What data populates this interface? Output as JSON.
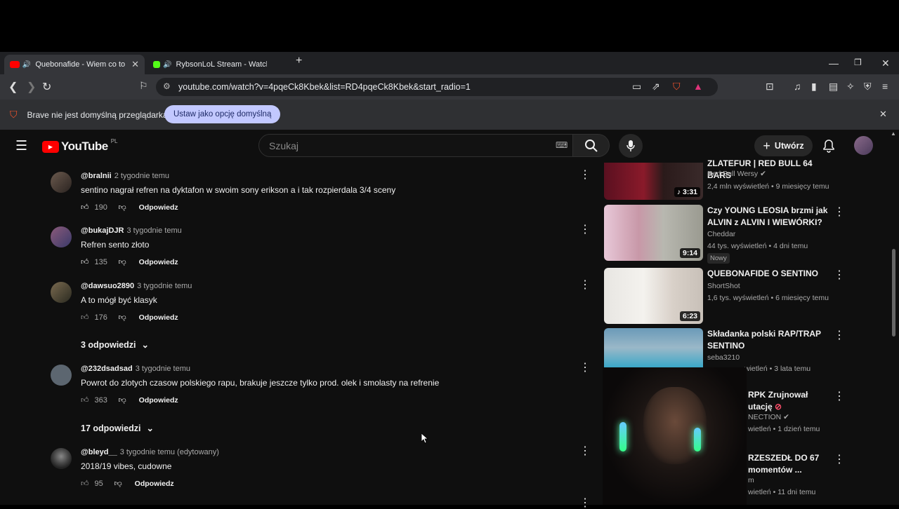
{
  "browser": {
    "tabs": [
      {
        "title": "Quebonafide - Wiem co to bó",
        "active": true
      },
      {
        "title": "RybsonLoL Stream - Watch Live o",
        "active": false
      }
    ],
    "new_tab": "+",
    "url": "youtube.com/watch?v=4pqeCk8Kbek&list=RD4pqeCk8Kbek&start_radio=1",
    "notification": {
      "text": "Brave nie jest domyślną przeglądarką",
      "button": "Ustaw jako opcję domyślną"
    }
  },
  "youtube": {
    "logo": "YouTube",
    "region": "PL",
    "search_placeholder": "Szukaj",
    "create_label": "Utwórz",
    "brand_color": "#ff0000"
  },
  "comments": [
    {
      "user": "@bralnii",
      "time": "2 tygodnie temu",
      "text": "sentino nagrał refren na dyktafon w swoim sony erikson a i tak rozpierdala 3/4 sceny",
      "likes": "190",
      "reply": "Odpowiedz"
    },
    {
      "user": "@bukajDJR",
      "time": "3 tygodnie temu",
      "text": "Refren sento złoto",
      "likes": "135",
      "reply": "Odpowiedz"
    },
    {
      "user": "@dawsuo2890",
      "time": "3 tygodnie temu",
      "text": "A to mógł być klasyk",
      "likes": "176",
      "reply": "Odpowiedz",
      "replies": "3 odpowiedzi"
    },
    {
      "user": "@232dsadsad",
      "time": "3 tygodnie temu",
      "text": "Powrot do zlotych czasow polskiego rapu, brakuje jeszcze tylko prod. olek i smolasty na refrenie",
      "likes": "363",
      "reply": "Odpowiedz",
      "replies": "17 odpowiedzi"
    },
    {
      "user": "@bleyd__",
      "time": "3 tygodnie temu (edytowany)",
      "text": "2018/19 vibes, cudowne",
      "likes": "95",
      "reply": "Odpowiedz"
    }
  ],
  "sidebar_videos": [
    {
      "title": "ZLATEFUR | RED BULL 64 BARS",
      "channel": "Red Bull Wersy",
      "verified": true,
      "views": "2,4 mln wyświetleń",
      "age": "9 miesięcy temu",
      "duration": "3:31"
    },
    {
      "title": "Czy YOUNG LEOSIA brzmi jak ALVIN z ALVIN I WIEWÓRKI?",
      "channel": "Cheddar",
      "verified": false,
      "views": "44 tys. wyświetleń",
      "age": "4 dni temu",
      "duration": "9:14",
      "badge": "Nowy"
    },
    {
      "title": "QUEBONAFIDE O SENTINO",
      "channel": "ShortShot",
      "verified": false,
      "views": "1,6 tys. wyświetleń",
      "age": "6 miesięcy temu",
      "duration": "6:23"
    },
    {
      "title": "Składanka polski RAP/TRAP SENTINO",
      "channel": "seba3210",
      "verified": false,
      "views": "wietleń",
      "age": "3 lata temu"
    },
    {
      "title": "RPK Zrujnował utację",
      "channel": "NECTION",
      "verified": true,
      "views": "wietleń",
      "age": "1 dzień temu"
    },
    {
      "title": "RZESZEDŁ DO 67 momentów ...",
      "channel": "m",
      "verified": false,
      "views": "wietleń",
      "age": "11 dni temu"
    }
  ]
}
